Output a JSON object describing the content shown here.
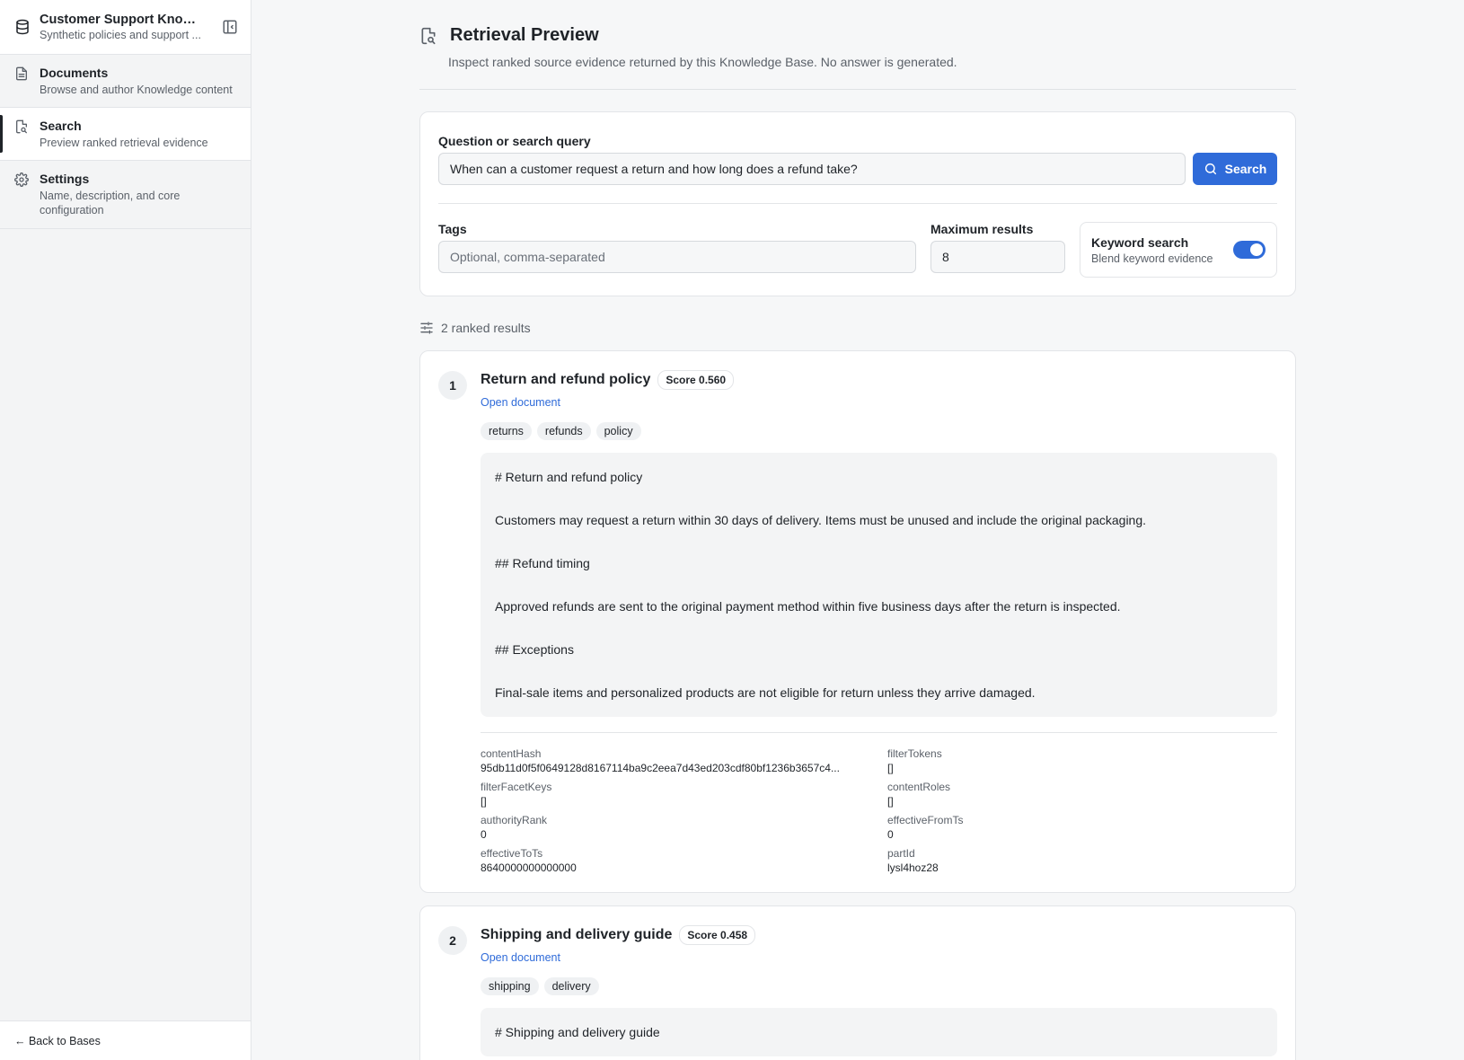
{
  "sidebar": {
    "base_title": "Customer Support Knowl...",
    "base_subtitle": "Synthetic policies and support ...",
    "items": [
      {
        "label": "Documents",
        "desc": "Browse and author Knowledge content"
      },
      {
        "label": "Search",
        "desc": "Preview ranked retrieval evidence"
      },
      {
        "label": "Settings",
        "desc": "Name, description, and core configuration"
      }
    ],
    "footer": "← Back to Bases"
  },
  "page": {
    "title": "Retrieval Preview",
    "subtitle": "Inspect ranked source evidence returned by this Knowledge Base. No answer is generated."
  },
  "query": {
    "label": "Question or search query",
    "value": "When can a customer request a return and how long does a refund take?",
    "search_label": "Search",
    "tags_label": "Tags",
    "tags_placeholder": "Optional, comma-separated",
    "max_label": "Maximum results",
    "max_value": "8",
    "keyword_title": "Keyword search",
    "keyword_desc": "Blend keyword evidence",
    "keyword_enabled": true
  },
  "results_summary": "2 ranked results",
  "results": [
    {
      "rank": "1",
      "title": "Return and refund policy",
      "score": "Score 0.560",
      "open_label": "Open document",
      "tags": [
        "returns",
        "refunds",
        "policy"
      ],
      "snippet": [
        "# Return and refund policy",
        "Customers may request a return within 30 days of delivery. Items must be unused and include the original packaging.",
        "## Refund timing",
        "Approved refunds are sent to the original payment method within five business days after the return is inspected.",
        "## Exceptions",
        "Final-sale items and personalized products are not eligible for return unless they arrive damaged."
      ],
      "meta": [
        {
          "key": "contentHash",
          "value": "95db11d0f5f0649128d8167114ba9c2eea7d43ed203cdf80bf1236b3657c4..."
        },
        {
          "key": "filterTokens",
          "value": "[]"
        },
        {
          "key": "filterFacetKeys",
          "value": "[]"
        },
        {
          "key": "contentRoles",
          "value": "[]"
        },
        {
          "key": "authorityRank",
          "value": "0"
        },
        {
          "key": "effectiveFromTs",
          "value": "0"
        },
        {
          "key": "effectiveToTs",
          "value": "8640000000000000"
        },
        {
          "key": "partId",
          "value": "lysl4hoz28"
        }
      ]
    },
    {
      "rank": "2",
      "title": "Shipping and delivery guide",
      "score": "Score 0.458",
      "open_label": "Open document",
      "tags": [
        "shipping",
        "delivery"
      ],
      "snippet": [
        "# Shipping and delivery guide"
      ]
    }
  ],
  "colors": {
    "accent": "#2f6bd9",
    "text": "#1f2328",
    "muted": "#5b6169"
  },
  "icons": {
    "base": "database-icon",
    "collapse": "sidebar-collapse-icon",
    "documents": "document-icon",
    "search": "document-search-icon",
    "settings": "gear-icon",
    "results": "sliders-icon",
    "search_button": "search-icon"
  }
}
